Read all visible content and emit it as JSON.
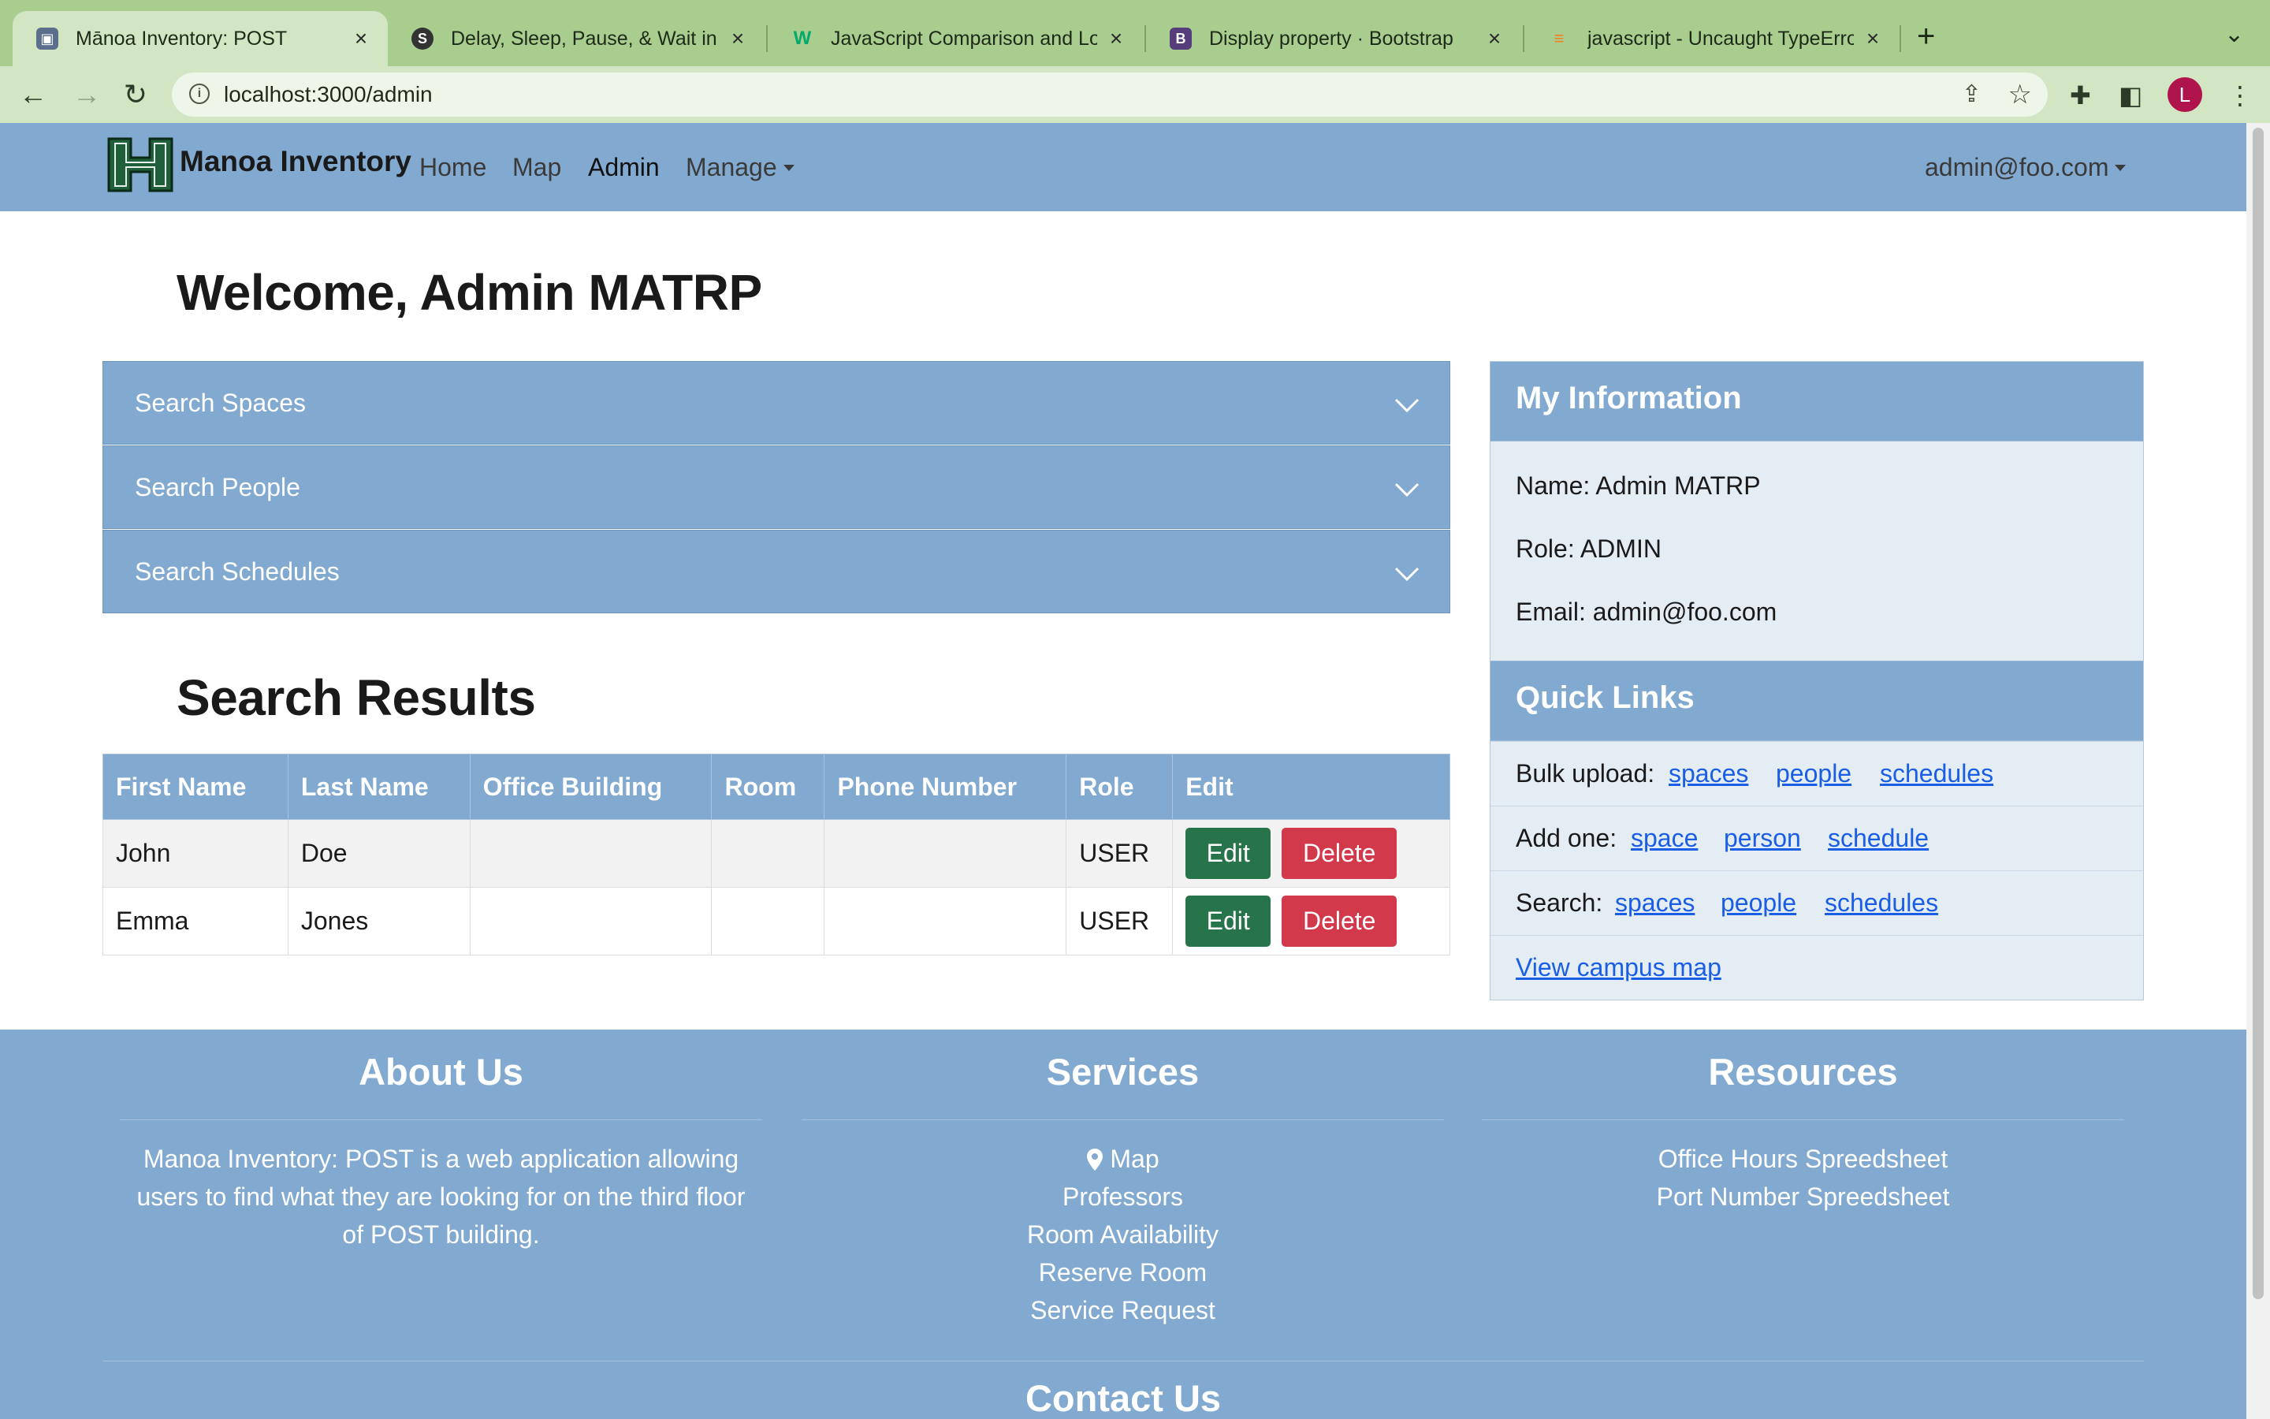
{
  "browser": {
    "tabs": [
      {
        "title": "Mānoa Inventory: POST",
        "active": true,
        "icon": "app-favicon"
      },
      {
        "title": "Delay, Sleep, Pause, & Wait in JavaScript",
        "active": false,
        "icon": "sitepoint-favicon"
      },
      {
        "title": "JavaScript Comparison and Logical Operators",
        "active": false,
        "icon": "w3schools-favicon"
      },
      {
        "title": "Display property · Bootstrap",
        "active": false,
        "icon": "bootstrap-favicon"
      },
      {
        "title": "javascript - Uncaught TypeError",
        "active": false,
        "icon": "stackoverflow-favicon"
      }
    ],
    "url": "localhost:3000/admin",
    "profile_initial": "L"
  },
  "navbar": {
    "brand": "Manoa Inventory",
    "links": [
      "Home",
      "Map",
      "Admin",
      "Manage"
    ],
    "active_link": "Admin",
    "user": "admin@foo.com"
  },
  "page": {
    "welcome": "Welcome, Admin MATRP",
    "accordion": [
      "Search Spaces",
      "Search People",
      "Search Schedules"
    ],
    "results_title": "Search Results"
  },
  "results_table": {
    "headers": [
      "First Name",
      "Last Name",
      "Office Building",
      "Room",
      "Phone Number",
      "Role",
      "Edit"
    ],
    "rows": [
      {
        "first": "John",
        "last": "Doe",
        "building": "",
        "room": "",
        "phone": "",
        "role": "USER"
      },
      {
        "first": "Emma",
        "last": "Jones",
        "building": "",
        "room": "",
        "phone": "",
        "role": "USER"
      }
    ],
    "edit_label": "Edit",
    "delete_label": "Delete"
  },
  "my_info": {
    "title": "My Information",
    "name": "Name: Admin MATRP",
    "role": "Role: ADMIN",
    "email": "Email: admin@foo.com"
  },
  "quick_links": {
    "title": "Quick Links",
    "bulk_label": "Bulk upload:",
    "bulk": [
      "spaces",
      "people",
      "schedules"
    ],
    "add_label": "Add one:",
    "add": [
      "space",
      "person",
      "schedule"
    ],
    "search_label": "Search:",
    "search": [
      "spaces",
      "people",
      "schedules"
    ],
    "map_link": "View campus map"
  },
  "footer": {
    "about_title": "About Us",
    "about_lines": [
      "Manoa Inventory: POST is a web application allowing",
      "users to find what they are looking for on the third floor",
      "of POST building."
    ],
    "services_title": "Services",
    "services": [
      "Map",
      "Professors",
      "Room Availability",
      "Reserve Room",
      "Service Request"
    ],
    "resources_title": "Resources",
    "resources": [
      "Office Hours Spreedsheet",
      "Port Number Spreedsheet"
    ],
    "contact_title": "Contact Us"
  },
  "colors": {
    "primary": "#82aad0",
    "edit_button": "#28744a",
    "delete_button": "#d2394b",
    "link": "#1a5ee6",
    "browser_frame": "#a8cd8f"
  }
}
